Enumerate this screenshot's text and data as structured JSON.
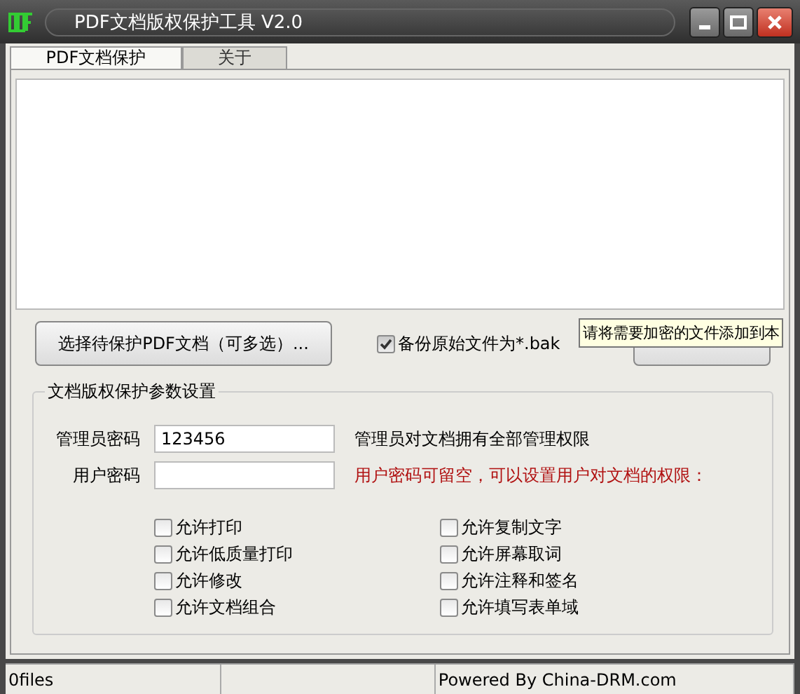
{
  "window": {
    "title": "PDF文档版权保护工具 V2.0"
  },
  "tabs": [
    {
      "label": "PDF文档保护",
      "selected": true
    },
    {
      "label": "关于",
      "selected": false
    }
  ],
  "select_button": {
    "label": "选择待保护PDF文档（可多选）..."
  },
  "backup": {
    "label": "备份原始文件为*.bak",
    "checked": true
  },
  "tooltip": {
    "text": "请将需要加密的文件添加到本"
  },
  "settings": {
    "title": "文档版权保护参数设置",
    "admin_password": {
      "label": "管理员密码",
      "value": "123456",
      "note": "管理员对文档拥有全部管理权限"
    },
    "user_password": {
      "label": "用户密码",
      "note": "用户密码可留空，可以设置用户对文档的权限："
    },
    "permissions": [
      {
        "label": "允许打印",
        "checked": false
      },
      {
        "label": "允许复制文字",
        "checked": false
      },
      {
        "label": "允许低质量打印",
        "checked": false
      },
      {
        "label": "允许屏幕取词",
        "checked": false
      },
      {
        "label": "允许修改",
        "checked": false
      },
      {
        "label": "允许注释和签名",
        "checked": false
      },
      {
        "label": "允许文档组合",
        "checked": false
      },
      {
        "label": "允许填写表单域",
        "checked": false
      }
    ]
  },
  "status_bar": [
    "0files",
    "Powered By China-DRM.com"
  ]
}
